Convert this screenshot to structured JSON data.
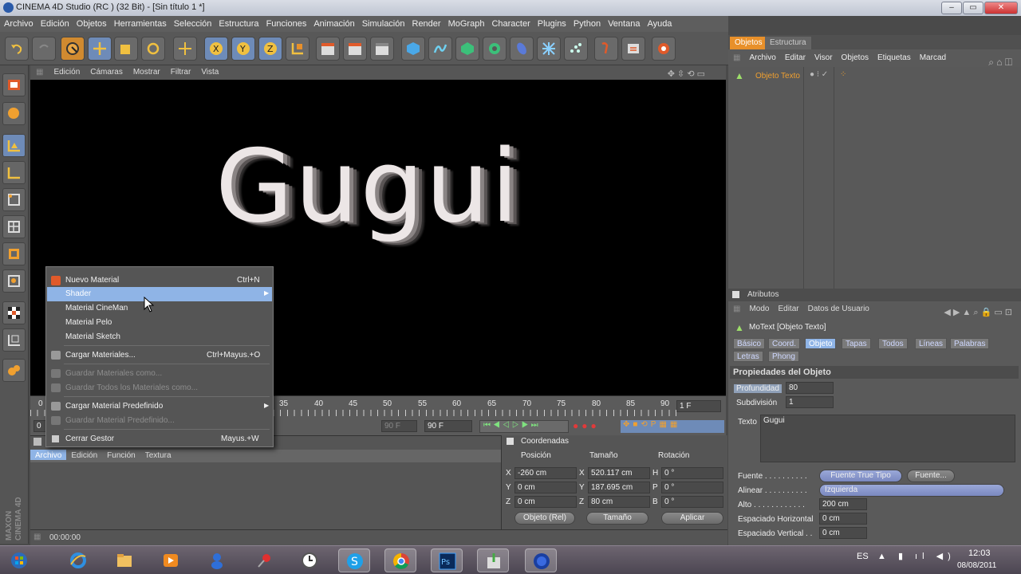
{
  "window": {
    "title": "CINEMA 4D Studio (RC ) (32 Bit) - [Sin título 1 *]"
  },
  "menubar": [
    "Archivo",
    "Edición",
    "Objetos",
    "Herramientas",
    "Selección",
    "Estructura",
    "Funciones",
    "Animación",
    "Simulación",
    "Render",
    "MoGraph",
    "Character",
    "Plugins",
    "Python",
    "Ventana",
    "Ayuda"
  ],
  "toolbar_icons": [
    "undo-icon",
    "redo-icon",
    "live-select-icon",
    "move-icon",
    "scale-icon",
    "rotate-icon",
    "move-tool-icon",
    "x-axis-icon",
    "y-axis-icon",
    "z-axis-icon",
    "coord-system-icon",
    "render-view-icon",
    "render-picture-queue-icon",
    "render-settings-icon",
    "cube-icon",
    "spline-icon",
    "nurbs-icon",
    "array-icon",
    "deformer-icon",
    "scene-icon",
    "particle-icon",
    "camera-icon",
    "light-icon",
    "sky-icon"
  ],
  "viewport": {
    "menu": [
      "Edición",
      "Cámaras",
      "Mostrar",
      "Filtrar",
      "Vista"
    ],
    "text": "Gugui"
  },
  "timeline": {
    "ticks": [
      "0",
      "35",
      "40",
      "45",
      "50",
      "55",
      "60",
      "65",
      "70",
      "75",
      "80",
      "85",
      "90"
    ],
    "frame_display": "1 F",
    "start_field": "0",
    "frame_field_a": "90 F",
    "frame_field_b": "90 F"
  },
  "context_menu": {
    "items": [
      {
        "label": "Nuevo Material",
        "shortcut": "Ctrl+N",
        "state": "normal"
      },
      {
        "label": "Shader",
        "shortcut": "",
        "state": "highlighted",
        "submenu": true
      },
      {
        "label": "Material CineMan",
        "shortcut": "",
        "state": "normal"
      },
      {
        "label": "Material Pelo",
        "shortcut": "",
        "state": "normal"
      },
      {
        "label": "Material Sketch",
        "shortcut": "",
        "state": "normal"
      },
      {
        "label": "Cargar Materiales...",
        "shortcut": "Ctrl+Mayus.+O",
        "state": "normal"
      },
      {
        "label": "Guardar Materiales como...",
        "shortcut": "",
        "state": "disabled"
      },
      {
        "label": "Guardar Todos los Materiales como...",
        "shortcut": "",
        "state": "disabled"
      },
      {
        "label": "Cargar Material Predefinido",
        "shortcut": "",
        "state": "normal",
        "submenu": true
      },
      {
        "label": "Guardar Material Predefinido...",
        "shortcut": "",
        "state": "disabled"
      },
      {
        "label": "Cerrar Gestor",
        "shortcut": "Mayus.+W",
        "state": "normal"
      }
    ]
  },
  "material_manager": {
    "menu": [
      "Archivo",
      "Edición",
      "Función",
      "Textura"
    ]
  },
  "coordinates": {
    "title": "Coordenadas",
    "headers": [
      "Posición",
      "Tamaño",
      "Rotación"
    ],
    "rows": [
      {
        "axis": "X",
        "pos": "-260 cm",
        "size_axis": "X",
        "size": "520.117 cm",
        "rot_axis": "H",
        "rot": "0 °"
      },
      {
        "axis": "Y",
        "pos": "0 cm",
        "size_axis": "Y",
        "size": "187.695 cm",
        "rot_axis": "P",
        "rot": "0 °"
      },
      {
        "axis": "Z",
        "pos": "0 cm",
        "size_axis": "Z",
        "size": "80 cm",
        "rot_axis": "B",
        "rot": "0 °"
      }
    ],
    "mode_select": "Objeto (Rel)",
    "size_select": "Tamaño",
    "apply": "Aplicar"
  },
  "status": {
    "time": "00:00:00"
  },
  "objects_panel": {
    "tabs": [
      "Objetos",
      "Estructura"
    ],
    "menu": [
      "Archivo",
      "Editar",
      "Visor",
      "Objetos",
      "Etiquetas",
      "Marcad"
    ],
    "object": "Objeto Texto"
  },
  "attributes": {
    "header": "Atributos",
    "menu": [
      "Modo",
      "Editar",
      "Datos de Usuario"
    ],
    "object_title": "MoText [Objeto Texto]",
    "tabs_row1": [
      "Básico",
      "Coord.",
      "Objeto",
      "Tapas",
      "Todos",
      "Líneas",
      "Palabras"
    ],
    "tabs_row2": [
      "Letras",
      "Phong"
    ],
    "section": "Propiedades del Objeto",
    "profundidad_label": "Profundidad",
    "profundidad": "80",
    "subdivision_label": "Subdivisión",
    "subdivision": "1",
    "texto_label": "Texto",
    "texto": "Gugui",
    "fuente_label": "Fuente . . . . . . . . . .",
    "fuente_value": "Fuente True Tipo",
    "fuente_button": "Fuente...",
    "alinear_label": "Alinear . . . . . . . . . .",
    "alinear_value": "Izquierda",
    "alto_label": "Alto . . . . . . . . . . . .",
    "alto_value": "200 cm",
    "esp_h_label": "Espaciado Horizontal",
    "esp_h_value": "0 cm",
    "esp_v_label": "Espaciado Vertical . .",
    "esp_v_value": "0 cm"
  },
  "branding": {
    "maxon": "MAXON",
    "cinema": "CINEMA 4D"
  },
  "taskbar": {
    "language": "ES",
    "time": "12:03",
    "date": "08/08/2011",
    "apps": [
      "start-orb-icon",
      "ie-icon",
      "explorer-icon",
      "media-player-icon",
      "messenger-icon",
      "pin-icon",
      "clock-icon",
      "skype-icon",
      "chrome-icon",
      "photoshop-icon",
      "installer-icon",
      "cinema4d-icon"
    ]
  }
}
